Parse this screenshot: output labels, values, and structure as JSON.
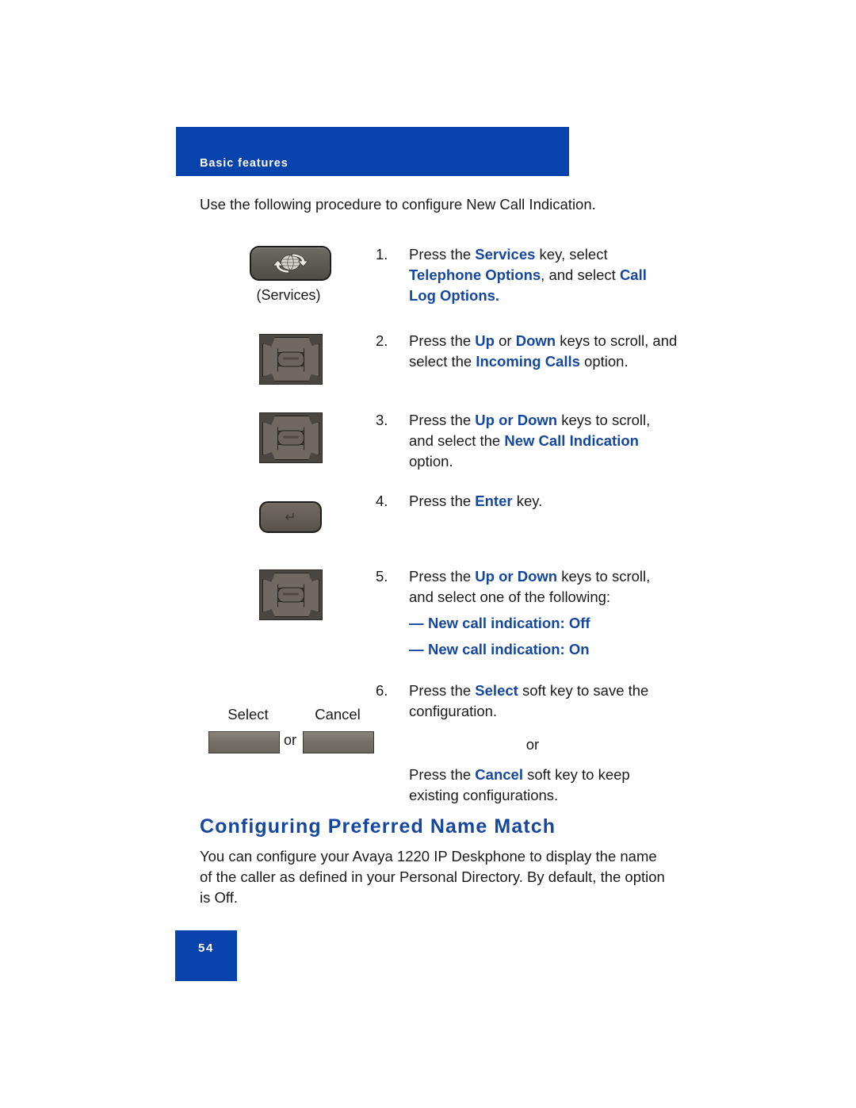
{
  "header": {
    "banner_label": "Basic features",
    "banner_color": "#0842AD"
  },
  "accent_color": "#15479E",
  "intro": "Use the following procedure to configure New Call Indication.",
  "steps": [
    {
      "number": "1.",
      "segments": [
        {
          "text": "Press the ",
          "style": "plain"
        },
        {
          "text": "Services",
          "style": "keyword"
        },
        {
          "text": " key, select ",
          "style": "plain"
        },
        {
          "text": "Telephone Options",
          "style": "keyword"
        },
        {
          "text": ", and select ",
          "style": "plain"
        },
        {
          "text": "Call Log Options.",
          "style": "keyword"
        }
      ],
      "icon": {
        "type": "services-key",
        "caption": "(Services)"
      }
    },
    {
      "number": "2.",
      "segments": [
        {
          "text": "Press the ",
          "style": "plain"
        },
        {
          "text": "Up",
          "style": "keyword"
        },
        {
          "text": " or ",
          "style": "plain"
        },
        {
          "text": "Down",
          "style": "keyword"
        },
        {
          "text": " keys to scroll, and select the ",
          "style": "plain"
        },
        {
          "text": "Incoming Calls",
          "style": "keyword"
        },
        {
          "text": " option.",
          "style": "plain"
        }
      ],
      "icon": {
        "type": "navigation-key",
        "caption": ""
      }
    },
    {
      "number": "3.",
      "segments": [
        {
          "text": "Press the ",
          "style": "plain"
        },
        {
          "text": "Up or Down",
          "style": "keyword"
        },
        {
          "text": " keys to scroll, and select the ",
          "style": "plain"
        },
        {
          "text": "New Call Indication",
          "style": "keyword"
        },
        {
          "text": " option.",
          "style": "plain"
        }
      ],
      "icon": {
        "type": "navigation-key",
        "caption": ""
      }
    },
    {
      "number": "4.",
      "segments": [
        {
          "text": "Press the ",
          "style": "plain"
        },
        {
          "text": "Enter",
          "style": "keyword"
        },
        {
          "text": " key.",
          "style": "plain"
        }
      ],
      "icon": {
        "type": "enter-key",
        "caption": ""
      }
    },
    {
      "number": "5.",
      "segments": [
        {
          "text": "Press the ",
          "style": "plain"
        },
        {
          "text": "Up or Down",
          "style": "keyword"
        },
        {
          "text": " keys to scroll, and select one of the following:",
          "style": "plain"
        }
      ],
      "options": [
        {
          "dash": "—",
          "label": "New call indication: Off"
        },
        {
          "dash": "—",
          "label": "New call indication: On"
        }
      ],
      "icon": {
        "type": "navigation-key",
        "caption": ""
      }
    },
    {
      "number": "6.",
      "segments": [
        {
          "text": "Press the ",
          "style": "plain"
        },
        {
          "text": "Select",
          "style": "keyword"
        },
        {
          "text": " soft key to save the configuration.",
          "style": "plain"
        }
      ],
      "or_divider": "or",
      "segments2": [
        {
          "text": "Press the ",
          "style": "plain"
        },
        {
          "text": "Cancel",
          "style": "keyword"
        },
        {
          "text": " soft key to keep existing configurations.",
          "style": "plain"
        }
      ],
      "icon": {
        "type": "soft-keys",
        "caption": ""
      }
    }
  ],
  "softkeys": {
    "select_label": "Select",
    "cancel_label": "Cancel",
    "or_label": "or"
  },
  "section": {
    "heading": "Configuring Preferred Name Match",
    "body": "You can configure your Avaya 1220 IP Deskphone to display the name of the caller as defined in your Personal Directory. By default, the option is Off."
  },
  "footer": {
    "page_number": "54"
  }
}
